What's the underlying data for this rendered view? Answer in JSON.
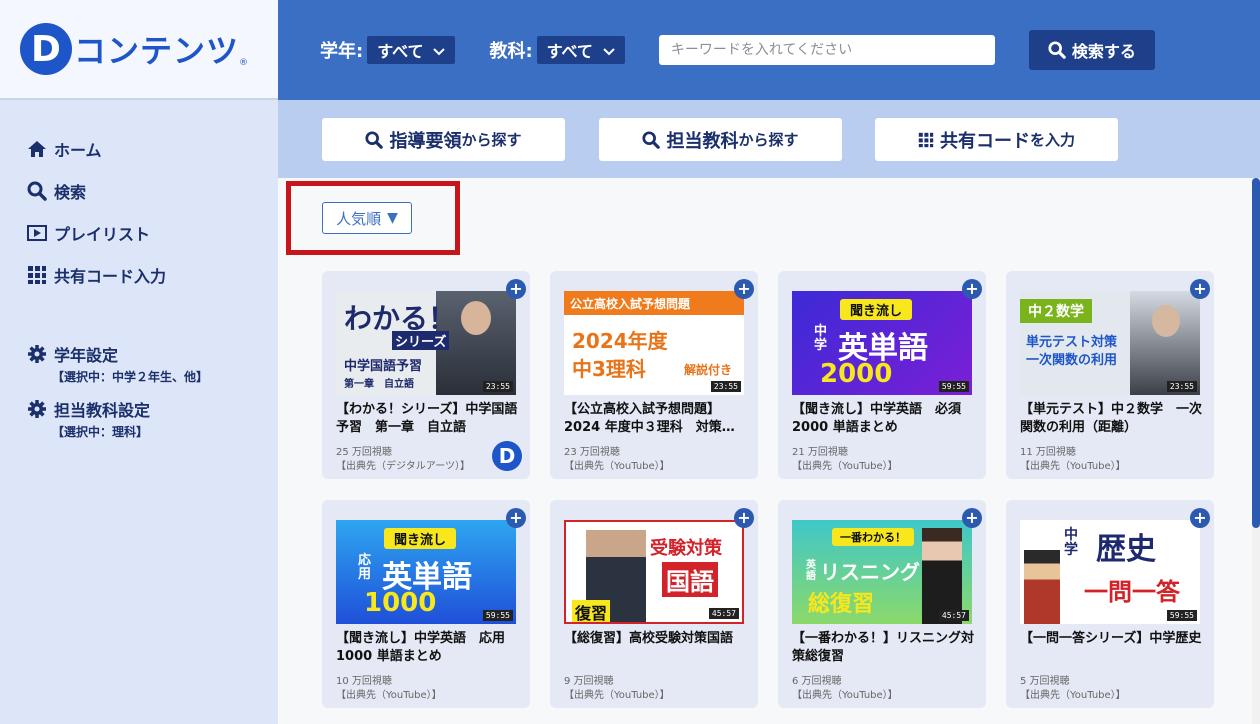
{
  "app": {
    "logo_mark": "D",
    "logo_text": "コンテンツ",
    "logo_reg": "®"
  },
  "sidebar": {
    "items": [
      {
        "label": "ホーム",
        "icon": "home-icon"
      },
      {
        "label": "検索",
        "icon": "search-icon"
      },
      {
        "label": "プレイリスト",
        "icon": "playlist-icon"
      },
      {
        "label": "共有コード入力",
        "icon": "grid-icon"
      }
    ],
    "settings": [
      {
        "label": "学年設定",
        "sub": "【選択中：中学２年生、他】",
        "icon": "gear-icon"
      },
      {
        "label": "担当教科設定",
        "sub": "【選択中：理科】",
        "icon": "gear-icon"
      }
    ]
  },
  "header": {
    "grade_label": "学年:",
    "grade_value": "すべて",
    "subject_label": "教科:",
    "subject_value": "すべて",
    "search_placeholder": "キーワードを入れてください",
    "search_button": "検索する"
  },
  "subbar": {
    "buttons": [
      {
        "big": "指導要領",
        "small": "から探す",
        "icon": "search-icon"
      },
      {
        "big": "担当教科",
        "small": "から探す",
        "icon": "search-icon"
      },
      {
        "big": "共有コード",
        "small": "を入力",
        "icon": "grid-icon"
      }
    ]
  },
  "sort": {
    "label": "人気順",
    "arrow": "▼"
  },
  "cards": [
    {
      "title": "【わかる！シリーズ】中学国語予習　第一章　自立語",
      "views": "25 万回視聴",
      "source": "【出典先（デジタルアーツ）】",
      "duration": "23:55",
      "thumb_lines": [
        "わかる！",
        "シリーズ",
        "中学国語予習",
        "第一章　自立語"
      ]
    },
    {
      "title": "【公立高校入試予想問題】2024 年度中３理科　対策…",
      "views": "23 万回視聴",
      "source": "【出典先（YouTube）】",
      "duration": "23:55",
      "thumb_lines": [
        "公立高校入試予想問題",
        "2024年度",
        "中3理科",
        "解説付き"
      ]
    },
    {
      "title": "【聞き流し】中学英語　必須 2000 単語まとめ",
      "views": "21 万回視聴",
      "source": "【出典先（YouTube）】",
      "duration": "59:55",
      "thumb_lines": [
        "聞き流し",
        "中学",
        "英単語",
        "2000"
      ]
    },
    {
      "title": "【単元テスト】中２数学　一次関数の利用（距離）",
      "views": "11 万回視聴",
      "source": "【出典先（YouTube）】",
      "duration": "23:55",
      "thumb_lines": [
        "中２数学",
        "単元テスト対策",
        "一次関数の利用"
      ]
    },
    {
      "title": "【聞き流し】中学英語　応用 1000 単語まとめ",
      "views": "10 万回視聴",
      "source": "【出典先（YouTube）】",
      "duration": "59:55",
      "thumb_lines": [
        "聞き流し",
        "応用",
        "英単語",
        "1000"
      ]
    },
    {
      "title": "【総復習】高校受験対策国語",
      "views": "9 万回視聴",
      "source": "【出典先（YouTube）】",
      "duration": "45:57",
      "thumb_lines": [
        "受験対策",
        "国語",
        "復習"
      ]
    },
    {
      "title": "【一番わかる！】リスニング対策総復習",
      "views": "6 万回視聴",
      "source": "【出典先（YouTube）】",
      "duration": "45:57",
      "thumb_lines": [
        "一番わかる！",
        "英語",
        "リスニング",
        "総復習"
      ]
    },
    {
      "title": "【一問一答シリーズ】中学歴史",
      "views": "5 万回視聴",
      "source": "【出典先（YouTube）】",
      "duration": "59:55",
      "thumb_lines": [
        "中学",
        "歴史",
        "一問一答"
      ]
    }
  ],
  "colors": {
    "header_bg": "#3b6fc4",
    "accent_dark": "#1e3f8a",
    "sidebar_bg": "#dde6f8",
    "subbar_bg": "#b9cdf0",
    "highlight": "#c8141b"
  }
}
